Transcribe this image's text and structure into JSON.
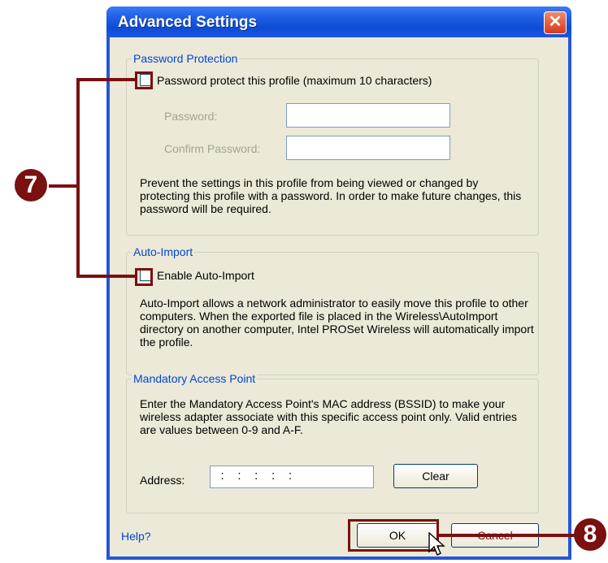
{
  "window": {
    "title": "Advanced Settings",
    "close_glyph": "✕"
  },
  "password_protection": {
    "group_title": "Password Protection",
    "checkbox_label": "Password protect this profile (maximum 10 characters)",
    "password_label": "Password:",
    "confirm_label": "Confirm Password:",
    "password_value": "",
    "confirm_value": "",
    "description": "Prevent the settings in this profile from being viewed or changed by protecting this profile with a password. In order to make future changes, this password will be required."
  },
  "auto_import": {
    "group_title": "Auto-Import",
    "checkbox_label": "Enable Auto-Import",
    "description": "Auto-Import allows a network administrator to easily move this profile to other computers. When the exported file is placed in the Wireless\\AutoImport directory on another computer, Intel PROSet Wireless will automatically import the profile."
  },
  "mandatory_ap": {
    "group_title": "Mandatory Access Point",
    "description": "Enter the Mandatory Access Point's MAC address (BSSID) to make your wireless adapter associate with this specific access point only. Valid entries are values between 0-9 and A-F.",
    "address_label": "Address:",
    "address_value": "   :    :    :    :    :",
    "clear_label": "Clear"
  },
  "footer": {
    "help_label": "Help?",
    "ok_label": "OK",
    "cancel_label": "Cancel"
  },
  "callouts": {
    "seven": "7",
    "eight": "8"
  }
}
